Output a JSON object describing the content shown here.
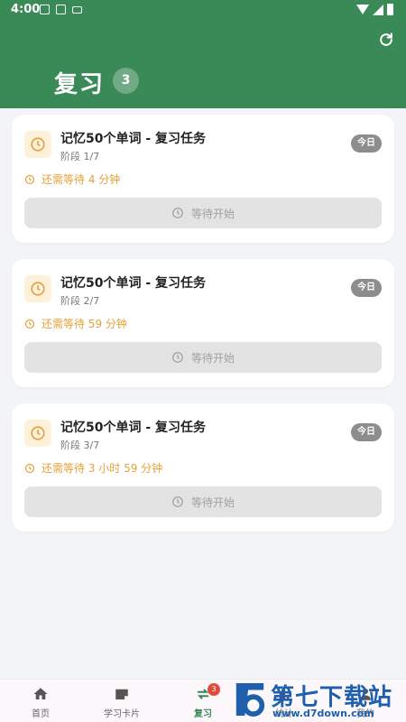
{
  "status_bar": {
    "time": "4:00"
  },
  "header": {
    "title": "复习",
    "count": "3",
    "refresh_icon": "refresh-icon"
  },
  "colors": {
    "primary": "#3a8a58",
    "warning": "#e6a13a",
    "tag": "#8d8d8d",
    "badge": "#e04b3c"
  },
  "cards": [
    {
      "title": "记忆50个单词 - 复习任务",
      "stage": "阶段 1/7",
      "tag": "今日",
      "wait": "还需等待 4 分钟",
      "button": "等待开始"
    },
    {
      "title": "记忆50个单词 - 复习任务",
      "stage": "阶段 2/7",
      "tag": "今日",
      "wait": "还需等待 59 分钟",
      "button": "等待开始"
    },
    {
      "title": "记忆50个单词 - 复习任务",
      "stage": "阶段 3/7",
      "tag": "今日",
      "wait": "还需等待 3 小时 59 分钟",
      "button": "等待开始"
    }
  ],
  "nav": {
    "items": [
      {
        "label": "首页",
        "icon": "home-icon"
      },
      {
        "label": "学习卡片",
        "icon": "card-icon"
      },
      {
        "label": "复习",
        "icon": "review-icon",
        "badge": "3",
        "active": true
      },
      {
        "label": "统计",
        "icon": "stats-icon"
      },
      {
        "label": "我的",
        "icon": "profile-icon"
      }
    ]
  },
  "watermark": {
    "title": "第七下载站",
    "url": "www.d7down.com"
  }
}
